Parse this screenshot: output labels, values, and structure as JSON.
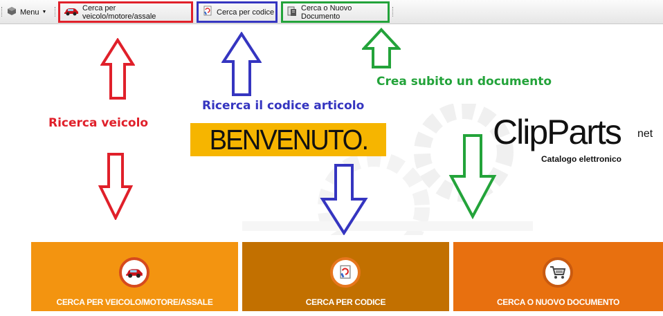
{
  "toolbar": {
    "menu_label": "Menu",
    "buttons": [
      {
        "label": "Cerca per veicolo/motore/assale",
        "icon": "car-icon"
      },
      {
        "label": "Cerca per codice",
        "icon": "code-search-icon"
      },
      {
        "label": "Cerca o Nuovo Documento",
        "icon": "document-icon"
      }
    ]
  },
  "annotations": {
    "vehicle": "Ricerca veicolo",
    "code": "Ricerca il codice articolo",
    "document": "Crea subito un documento"
  },
  "welcome": "BENVENUTO.",
  "logo": {
    "brand": "ClipParts",
    "suffix": "net",
    "tagline": "Catalogo elettronico"
  },
  "cards": [
    {
      "label": "CERCA PER VEICOLO/MOTORE/ASSALE",
      "icon": "car-icon"
    },
    {
      "label": "CERCA PER CODICE",
      "icon": "code-search-icon"
    },
    {
      "label": "CERCA O NUOVO DOCUMENTO",
      "icon": "cart-icon"
    }
  ],
  "colors": {
    "red": "#e0202a",
    "blue": "#3535c0",
    "green": "#23a33a",
    "card_vehicle": "#f39410",
    "card_code": "#c27000",
    "card_document": "#e8700f",
    "welcome_bg": "#f6b500"
  }
}
